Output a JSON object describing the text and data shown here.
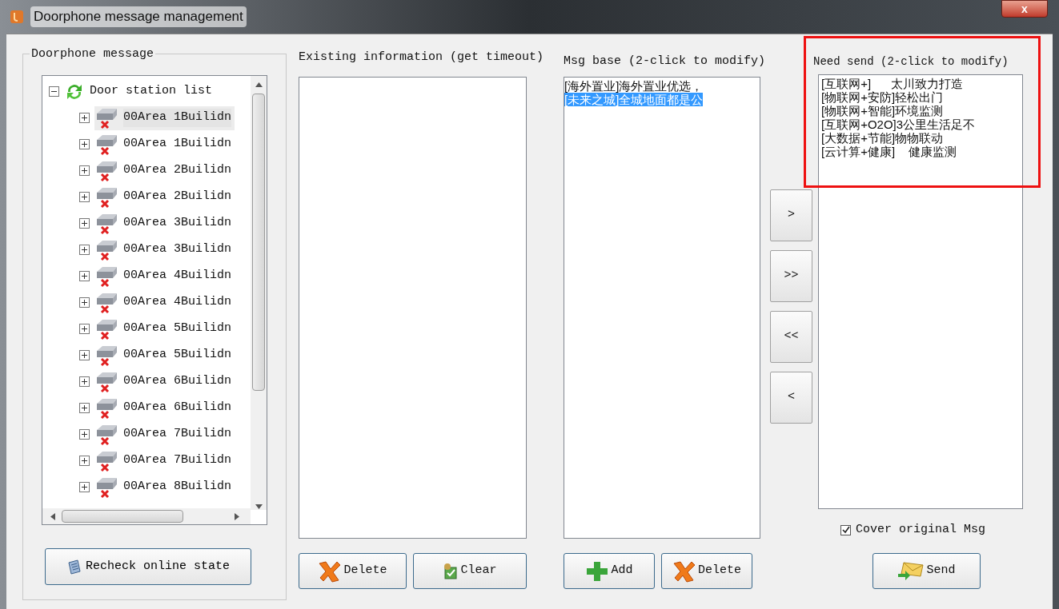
{
  "window": {
    "title": "Doorphone message management",
    "close_label": "x"
  },
  "doorphone_group": {
    "title": "Doorphone message",
    "tree": [
      {
        "label": "Door station list",
        "kind": "root",
        "expanded": true,
        "selected": false,
        "children": [
          {
            "label": "00Area 1Builidn",
            "expanded": false,
            "selected": true
          },
          {
            "label": "00Area 1Builidn",
            "expanded": false,
            "selected": false
          },
          {
            "label": "00Area 2Builidn",
            "expanded": false,
            "selected": false
          },
          {
            "label": "00Area 2Builidn",
            "expanded": false,
            "selected": false
          },
          {
            "label": "00Area 3Builidn",
            "expanded": false,
            "selected": false
          },
          {
            "label": "00Area 3Builidn",
            "expanded": false,
            "selected": false
          },
          {
            "label": "00Area 4Builidn",
            "expanded": false,
            "selected": false
          },
          {
            "label": "00Area 4Builidn",
            "expanded": false,
            "selected": false
          },
          {
            "label": "00Area 5Builidn",
            "expanded": false,
            "selected": false
          },
          {
            "label": "00Area 5Builidn",
            "expanded": false,
            "selected": false
          },
          {
            "label": "00Area 6Builidn",
            "expanded": false,
            "selected": false
          },
          {
            "label": "00Area 6Builidn",
            "expanded": false,
            "selected": false
          },
          {
            "label": "00Area 7Builidn",
            "expanded": false,
            "selected": false
          },
          {
            "label": "00Area 7Builidn",
            "expanded": false,
            "selected": false
          },
          {
            "label": "00Area 8Builidn",
            "expanded": false,
            "selected": false
          }
        ]
      }
    ],
    "button": "Recheck online state"
  },
  "existing_info": {
    "label": "Existing information (get timeout)",
    "buttons": [
      {
        "label": "Delete",
        "kind": "delete"
      },
      {
        "label": "Clear",
        "kind": "clear"
      }
    ]
  },
  "msg_base": {
    "label": "Msg base (2-click to modify)",
    "items": [
      {
        "text": "[海外置业]海外置业优选，",
        "selected": false
      },
      {
        "text": "[未来之城]全城地面都是公",
        "selected": true
      }
    ],
    "buttons": [
      {
        "label": "Add",
        "kind": "add"
      },
      {
        "label": "Delete",
        "kind": "delete"
      }
    ]
  },
  "move_buttons": [
    ">",
    ">>",
    "<<",
    "<"
  ],
  "need_send": {
    "label": "Need send (2-click to modify)",
    "items": [
      {
        "text": "[互联网+]      太川致力打造",
        "selected": false
      },
      {
        "text": "[物联网+安防]轻松出门",
        "selected": false
      },
      {
        "text": "[物联网+智能]环境监测",
        "selected": false
      },
      {
        "text": "[互联网+O2O]3公里生活足不",
        "selected": false
      },
      {
        "text": "[大数据+节能]物物联动",
        "selected": false
      },
      {
        "text": "[云计算+健康]    健康监测",
        "selected": false
      }
    ],
    "cover_original": {
      "label": "Cover original Msg",
      "checked": true
    },
    "buttons": [
      {
        "label": "Send",
        "kind": "send"
      }
    ]
  }
}
